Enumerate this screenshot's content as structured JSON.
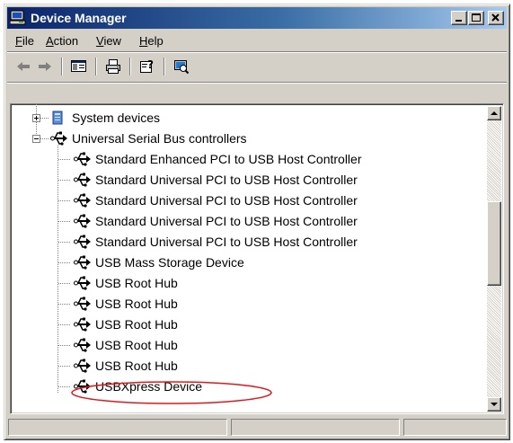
{
  "window": {
    "title": "Device Manager",
    "icon": "computer-icon",
    "controls": [
      "minimize-icon",
      "maximize-icon",
      "close-icon"
    ]
  },
  "menu": [
    {
      "label": "File",
      "mnemonic": "F"
    },
    {
      "label": "Action",
      "mnemonic": "A"
    },
    {
      "label": "View",
      "mnemonic": "V"
    },
    {
      "label": "Help",
      "mnemonic": "H"
    }
  ],
  "toolbar": {
    "buttons": [
      "back-arrow-icon",
      "forward-arrow-icon",
      "show-hide-console-tree-icon",
      "print-icon",
      "help-icon",
      "scan-hardware-icon"
    ]
  },
  "tree": {
    "nodes": [
      {
        "label": "System devices",
        "level": 1,
        "expanded": false,
        "icon": "system-devices-icon"
      },
      {
        "label": "Universal Serial Bus controllers",
        "level": 1,
        "expanded": true,
        "icon": "usb-icon"
      },
      {
        "label": "Standard Enhanced PCI to USB Host Controller",
        "level": 2,
        "icon": "usb-icon"
      },
      {
        "label": "Standard Universal PCI to USB Host Controller",
        "level": 2,
        "icon": "usb-icon"
      },
      {
        "label": "Standard Universal PCI to USB Host Controller",
        "level": 2,
        "icon": "usb-icon"
      },
      {
        "label": "Standard Universal PCI to USB Host Controller",
        "level": 2,
        "icon": "usb-icon"
      },
      {
        "label": "Standard Universal PCI to USB Host Controller",
        "level": 2,
        "icon": "usb-icon"
      },
      {
        "label": "USB Mass Storage Device",
        "level": 2,
        "icon": "usb-icon"
      },
      {
        "label": "USB Root Hub",
        "level": 2,
        "icon": "usb-icon"
      },
      {
        "label": "USB Root Hub",
        "level": 2,
        "icon": "usb-icon"
      },
      {
        "label": "USB Root Hub",
        "level": 2,
        "icon": "usb-icon"
      },
      {
        "label": "USB Root Hub",
        "level": 2,
        "icon": "usb-icon"
      },
      {
        "label": "USB Root Hub",
        "level": 2,
        "icon": "usb-icon"
      },
      {
        "label": "USBXpress Device",
        "level": 2,
        "icon": "usb-icon",
        "highlighted": true
      }
    ],
    "highlight_color": "#e0191e"
  },
  "statusbar": {
    "panes": [
      "",
      "",
      ""
    ]
  },
  "colors": {
    "title_active_start": "#0a246a",
    "title_active_end": "#a6caf0",
    "face": "#d4d0c8"
  }
}
